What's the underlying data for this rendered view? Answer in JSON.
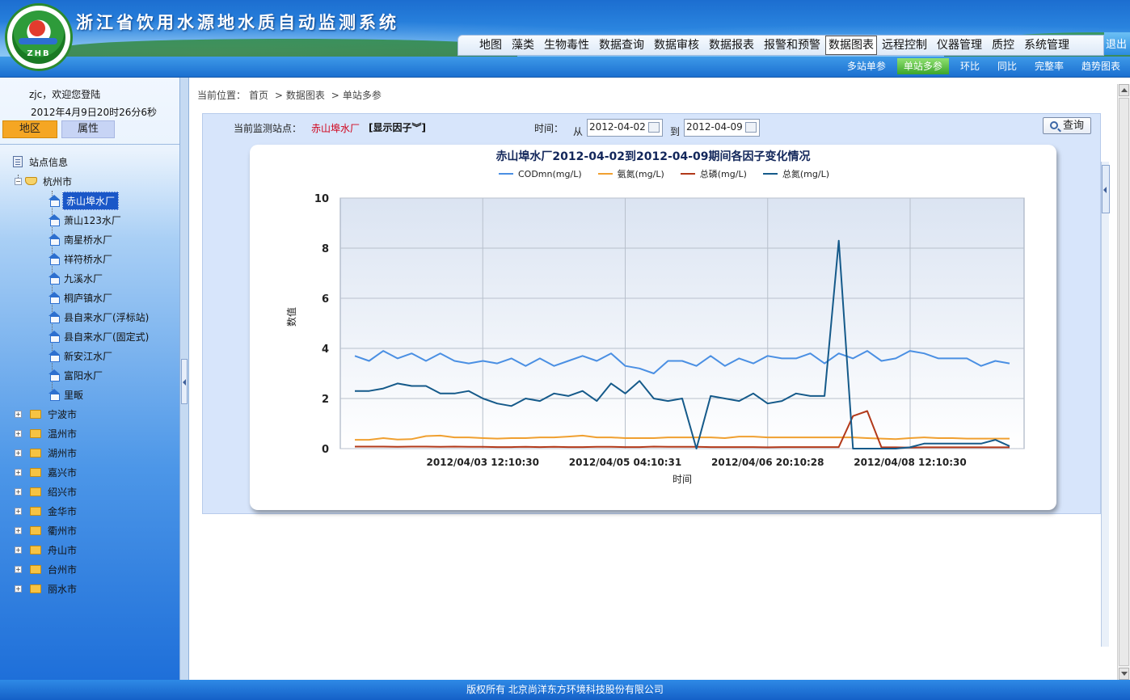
{
  "app": {
    "title": "浙江省饮用水源地水质自动监测系统",
    "logo_text": "ZHB"
  },
  "top_nav": {
    "items": [
      "地图",
      "藻类",
      "生物毒性",
      "数据查询",
      "数据审核",
      "数据报表",
      "报警和预警",
      "数据图表",
      "远程控制",
      "仪器管理",
      "质控",
      "系统管理"
    ],
    "active": "数据图表",
    "logout": "退出"
  },
  "sub_nav": {
    "items": [
      "多站单参",
      "单站多参",
      "环比",
      "同比",
      "完整率",
      "趋势图表"
    ],
    "active": "单站多参"
  },
  "sidebar": {
    "welcome": "zjc，欢迎您登陆",
    "datetime": "2012年4月9日20时26分6秒",
    "tabs": [
      "地区",
      "属性"
    ],
    "tree": {
      "root": "站点信息",
      "expanded_city": "杭州市",
      "stations": [
        "赤山埠水厂",
        "萧山123水厂",
        "南星桥水厂",
        "祥符桥水厂",
        "九溪水厂",
        "桐庐镇水厂",
        "县自来水厂(浮标站)",
        "县自来水厂(固定式)",
        "新安江水厂",
        "富阳水厂",
        "里畈"
      ],
      "selected_station": "赤山埠水厂",
      "other_cities": [
        "宁波市",
        "温州市",
        "湖州市",
        "嘉兴市",
        "绍兴市",
        "金华市",
        "衢州市",
        "舟山市",
        "台州市",
        "丽水市"
      ]
    }
  },
  "breadcrumb": {
    "prefix": "当前位置：",
    "parts": [
      "首页",
      "数据图表",
      "单站多参"
    ],
    "separator": ">"
  },
  "filter": {
    "station_label": "当前监测站点：",
    "station_value": "赤山埠水厂",
    "factor_toggle": "[显示因子︾]",
    "time_label": "时间：",
    "from_label": "从",
    "from_date": "2012-04-02",
    "to_label": "到",
    "to_date": "2012-04-09",
    "query_button": "查询"
  },
  "chart_data": {
    "type": "line",
    "title": "赤山埠水厂2012-04-02到2012-04-09期间各因子变化情况",
    "xlabel": "时间",
    "ylabel": "数值",
    "ylim": [
      0,
      10
    ],
    "yticks": [
      0,
      2,
      4,
      6,
      8,
      10
    ],
    "xtick_labels": [
      "2012/04/03 12:10:30",
      "2012/04/05 04:10:31",
      "2012/04/06 20:10:28",
      "2012/04/08 12:10:30"
    ],
    "grid": true,
    "legend_position": "top",
    "series": [
      {
        "name": "CODmn(mg/L)",
        "color": "#4a8fe3",
        "values": [
          3.7,
          3.5,
          3.9,
          3.6,
          3.8,
          3.5,
          3.8,
          3.5,
          3.4,
          3.5,
          3.4,
          3.6,
          3.3,
          3.6,
          3.3,
          3.5,
          3.7,
          3.5,
          3.8,
          3.3,
          3.2,
          3.0,
          3.5,
          3.5,
          3.3,
          3.7,
          3.3,
          3.6,
          3.4,
          3.7,
          3.6,
          3.6,
          3.8,
          3.4,
          3.8,
          3.6,
          3.9,
          3.5,
          3.6,
          3.9,
          3.8,
          3.6,
          3.6,
          3.6,
          3.3,
          3.5,
          3.4
        ]
      },
      {
        "name": "氨氮(mg/L)",
        "color": "#f0a030",
        "values": [
          0.35,
          0.35,
          0.42,
          0.36,
          0.38,
          0.5,
          0.52,
          0.45,
          0.45,
          0.42,
          0.4,
          0.42,
          0.42,
          0.45,
          0.45,
          0.48,
          0.52,
          0.45,
          0.45,
          0.42,
          0.42,
          0.42,
          0.45,
          0.45,
          0.45,
          0.45,
          0.42,
          0.48,
          0.48,
          0.45,
          0.45,
          0.45,
          0.45,
          0.45,
          0.45,
          0.45,
          0.42,
          0.4,
          0.38,
          0.42,
          0.45,
          0.42,
          0.42,
          0.4,
          0.4,
          0.4,
          0.4
        ]
      },
      {
        "name": "总磷(mg/L)",
        "color": "#b2391a",
        "values": [
          0.08,
          0.08,
          0.08,
          0.07,
          0.08,
          0.08,
          0.07,
          0.08,
          0.07,
          0.07,
          0.06,
          0.06,
          0.07,
          0.06,
          0.07,
          0.06,
          0.06,
          0.07,
          0.07,
          0.06,
          0.06,
          0.08,
          0.07,
          0.07,
          0.07,
          0.06,
          0.06,
          0.06,
          0.06,
          0.05,
          0.06,
          0.06,
          0.06,
          0.06,
          0.06,
          1.3,
          1.5,
          0.05,
          0.05,
          0.04,
          0.05,
          0.05,
          0.05,
          0.05,
          0.05,
          0.05,
          0.05
        ]
      },
      {
        "name": "总氮(mg/L)",
        "color": "#155a8a",
        "values": [
          2.3,
          2.3,
          2.4,
          2.6,
          2.5,
          2.5,
          2.2,
          2.2,
          2.3,
          2.0,
          1.8,
          1.7,
          2.0,
          1.9,
          2.2,
          2.1,
          2.3,
          1.9,
          2.6,
          2.2,
          2.7,
          2.0,
          1.9,
          2.0,
          0.0,
          2.1,
          2.0,
          1.9,
          2.2,
          1.8,
          1.9,
          2.2,
          2.1,
          2.1,
          8.3,
          0.0,
          0.0,
          0.0,
          0.0,
          0.05,
          0.2,
          0.2,
          0.2,
          0.2,
          0.2,
          0.35,
          0.1
        ]
      }
    ]
  },
  "footer": {
    "copyright": "版权所有  北京尚洋东方环境科技股份有限公司"
  }
}
